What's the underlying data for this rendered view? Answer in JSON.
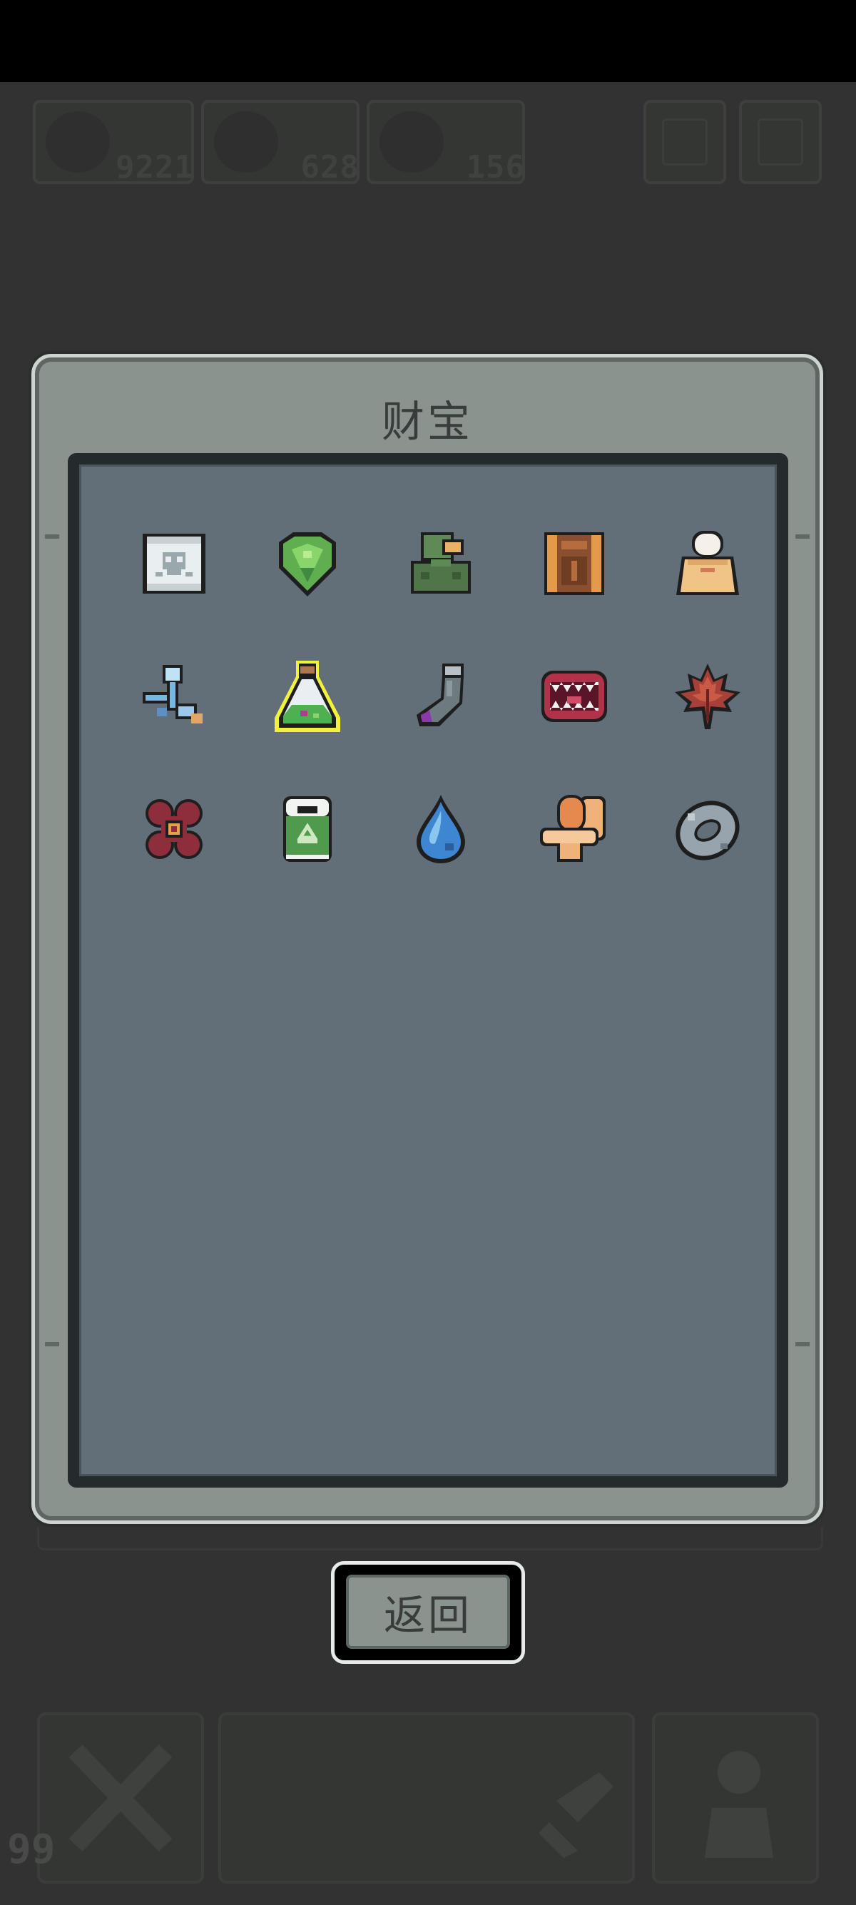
{
  "hud": {
    "resources": [
      {
        "icon": "water-drop-icon",
        "value": "9221"
      },
      {
        "icon": "helmet-icon",
        "value": "628"
      },
      {
        "icon": "gem-icon",
        "value": "156"
      }
    ],
    "buttons": [
      "menu-icon",
      "settings-icon"
    ]
  },
  "panel": {
    "title": "财宝",
    "items": [
      {
        "name": "skull-scroll",
        "icon": "skull-scroll-icon"
      },
      {
        "name": "green-gem",
        "icon": "green-gem-icon"
      },
      {
        "name": "green-helmet",
        "icon": "green-helmet-icon"
      },
      {
        "name": "leather-book",
        "icon": "leather-book-icon"
      },
      {
        "name": "cream-pouch",
        "icon": "cream-pouch-icon"
      },
      {
        "name": "blue-key",
        "icon": "blue-key-icon"
      },
      {
        "name": "potion-flask",
        "icon": "potion-flask-icon",
        "selected": true
      },
      {
        "name": "grey-sock",
        "icon": "grey-sock-icon"
      },
      {
        "name": "fanged-mouth",
        "icon": "fanged-mouth-icon"
      },
      {
        "name": "maple-leaf",
        "icon": "maple-leaf-icon"
      },
      {
        "name": "red-flower",
        "icon": "red-flower-icon"
      },
      {
        "name": "recycle-jar",
        "icon": "recycle-jar-icon"
      },
      {
        "name": "water-drop",
        "icon": "water-drop-icon"
      },
      {
        "name": "toilet",
        "icon": "toilet-icon"
      },
      {
        "name": "iron-ring",
        "icon": "iron-ring-icon"
      }
    ]
  },
  "back_button": {
    "label": "返回"
  },
  "bottom_bar": {
    "count": "99"
  },
  "colors": {
    "selected_outline": "#f2f23a",
    "panel": "#8b938e",
    "inner": "#626f78"
  }
}
